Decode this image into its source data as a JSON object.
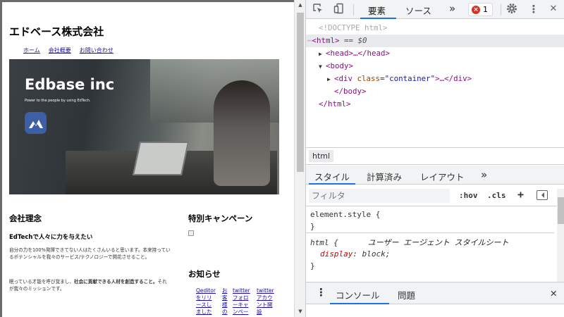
{
  "site": {
    "title": "エドベース株式会社",
    "nav": [
      "ホーム",
      "会社概要",
      "お問い合わせ"
    ],
    "hero": {
      "brand": "Edbase inc",
      "tagline": "Power to the people by using EdTech."
    },
    "philosophy": {
      "heading": "会社理念",
      "subheading": "EdTechで人々に力を与えたい",
      "paragraph1": "自分の力を100%発揮できてない人はたくさんいると思います。本来持っているポテンシャルを我々のサービス/テクノロジーで開花させること。",
      "paragraph2_normal": "眠っている才能を呼び覚まし、",
      "paragraph2_bold": "社会に貢献できる人材を創造すること。",
      "paragraph2_tail": "それが我々のミッションです。"
    },
    "campaign": {
      "heading": "特別キャンペーン"
    },
    "news": {
      "heading": "お知らせ",
      "items": [
        [
          "Qeditor",
          "をリリ",
          "ースし",
          "ました"
        ],
        [
          "お",
          "客",
          "様",
          "の"
        ],
        [
          "twitter",
          "フォロ",
          "ーキャ",
          "ンペー"
        ],
        [
          "twitter",
          "アカウ",
          "ント開",
          "設"
        ]
      ]
    }
  },
  "devtools": {
    "tabs": {
      "elements": "要素",
      "sources": "ソース",
      "more": "»"
    },
    "error_count": "1",
    "dom": {
      "doctype": "<!DOCTYPE html>",
      "html_open": "<html>",
      "sel_hint": "== $0",
      "head": "<head>…</head>",
      "body_open": "<body>",
      "div_tag": "div",
      "div_attr_name": "class",
      "div_attr_value": "\"container\"",
      "div_tail": ">…</div>",
      "body_close": "</body>",
      "html_close": "</html>"
    },
    "breadcrumb": "html",
    "styles_tabs": {
      "styles": "スタイル",
      "computed": "計算済み",
      "layout": "レイアウト",
      "more": "»"
    },
    "filter": {
      "placeholder": "フィルタ",
      "hov": ":hov",
      "cls": ".cls",
      "plus": "+"
    },
    "rules": {
      "element_style": "element.style {",
      "close": "}",
      "html_selector": "html {",
      "ua_label": "ユーザー エージェント スタイルシート",
      "prop_name": "display",
      "prop_value": "block;"
    },
    "drawer": {
      "console": "コンソール",
      "issues": "問題",
      "close": "✕"
    }
  }
}
